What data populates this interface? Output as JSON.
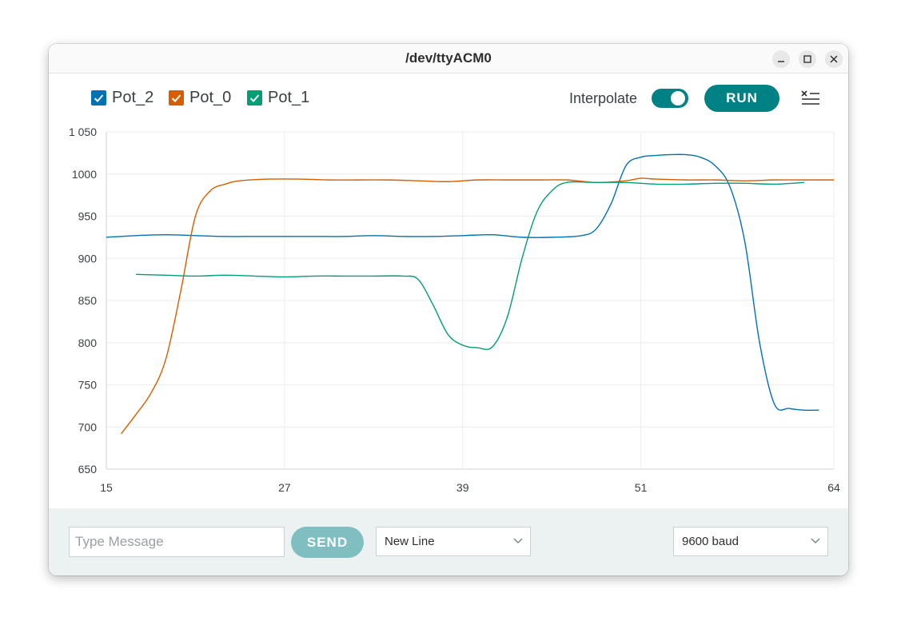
{
  "window": {
    "title": "/dev/ttyACM0"
  },
  "legend": {
    "items": [
      {
        "label": "Pot_2",
        "color": "#0071b3",
        "checked": true
      },
      {
        "label": "Pot_0",
        "color": "#d55e00",
        "checked": true
      },
      {
        "label": "Pot_1",
        "color": "#009e73",
        "checked": true
      }
    ]
  },
  "controls": {
    "interpolate_label": "Interpolate",
    "interpolate_on": true,
    "run_label": "RUN",
    "clear_icon": "clear-list-icon"
  },
  "bottom": {
    "message_placeholder": "Type Message",
    "send_label": "SEND",
    "line_ending": "New Line",
    "baud": "9600 baud"
  },
  "colors": {
    "accent": "#008184",
    "send_disabled": "#7fbfc1",
    "bottom_bg": "#ecf1f1"
  },
  "chart_data": {
    "type": "line",
    "xlim": [
      15,
      64
    ],
    "ylim": [
      650,
      1050
    ],
    "xticks": [
      15,
      27,
      39,
      51,
      64
    ],
    "yticks": [
      650,
      700,
      750,
      800,
      850,
      900,
      950,
      1000,
      1050
    ],
    "ytick_labels": [
      "650",
      "700",
      "750",
      "800",
      "850",
      "900",
      "950",
      "1000",
      "1 050"
    ],
    "grid": true,
    "series": [
      {
        "name": "Pot_2",
        "color": "#0071b3",
        "points": [
          [
            15,
            925
          ],
          [
            17,
            927
          ],
          [
            19,
            928
          ],
          [
            21,
            927
          ],
          [
            23,
            926
          ],
          [
            25,
            926
          ],
          [
            27,
            926
          ],
          [
            29,
            926
          ],
          [
            31,
            926
          ],
          [
            33,
            927
          ],
          [
            35,
            926
          ],
          [
            37,
            926
          ],
          [
            39,
            927
          ],
          [
            41,
            928
          ],
          [
            43,
            925
          ],
          [
            45,
            925
          ],
          [
            47,
            927
          ],
          [
            48,
            935
          ],
          [
            49,
            965
          ],
          [
            50,
            1010
          ],
          [
            51,
            1020
          ],
          [
            52,
            1022
          ],
          [
            53,
            1023
          ],
          [
            54,
            1023
          ],
          [
            55,
            1020
          ],
          [
            56,
            1010
          ],
          [
            57,
            985
          ],
          [
            58,
            920
          ],
          [
            59,
            800
          ],
          [
            60,
            727
          ],
          [
            61,
            722
          ],
          [
            62,
            720
          ],
          [
            63,
            720
          ]
        ]
      },
      {
        "name": "Pot_0",
        "color": "#d55e00",
        "points": [
          [
            16,
            692
          ],
          [
            17,
            715
          ],
          [
            18,
            740
          ],
          [
            19,
            780
          ],
          [
            20,
            860
          ],
          [
            21,
            950
          ],
          [
            22,
            980
          ],
          [
            23,
            988
          ],
          [
            24,
            992
          ],
          [
            26,
            994
          ],
          [
            28,
            994
          ],
          [
            30,
            993
          ],
          [
            32,
            993
          ],
          [
            34,
            993
          ],
          [
            36,
            992
          ],
          [
            38,
            991
          ],
          [
            40,
            993
          ],
          [
            42,
            993
          ],
          [
            44,
            993
          ],
          [
            46,
            993
          ],
          [
            48,
            990
          ],
          [
            50,
            992
          ],
          [
            51,
            995
          ],
          [
            52,
            994
          ],
          [
            54,
            993
          ],
          [
            56,
            993
          ],
          [
            58,
            992
          ],
          [
            60,
            993
          ],
          [
            62,
            993
          ],
          [
            64,
            993
          ]
        ]
      },
      {
        "name": "Pot_1",
        "color": "#009e73",
        "points": [
          [
            17,
            881
          ],
          [
            19,
            880
          ],
          [
            21,
            879
          ],
          [
            23,
            880
          ],
          [
            25,
            879
          ],
          [
            27,
            878
          ],
          [
            29,
            879
          ],
          [
            31,
            879
          ],
          [
            33,
            879
          ],
          [
            35,
            879
          ],
          [
            36,
            875
          ],
          [
            37,
            845
          ],
          [
            38,
            810
          ],
          [
            39,
            797
          ],
          [
            40,
            794
          ],
          [
            41,
            795
          ],
          [
            42,
            830
          ],
          [
            43,
            900
          ],
          [
            44,
            955
          ],
          [
            45,
            980
          ],
          [
            46,
            990
          ],
          [
            48,
            990
          ],
          [
            50,
            990
          ],
          [
            52,
            988
          ],
          [
            54,
            988
          ],
          [
            56,
            989
          ],
          [
            58,
            989
          ],
          [
            60,
            988
          ],
          [
            62,
            990
          ]
        ]
      }
    ]
  }
}
